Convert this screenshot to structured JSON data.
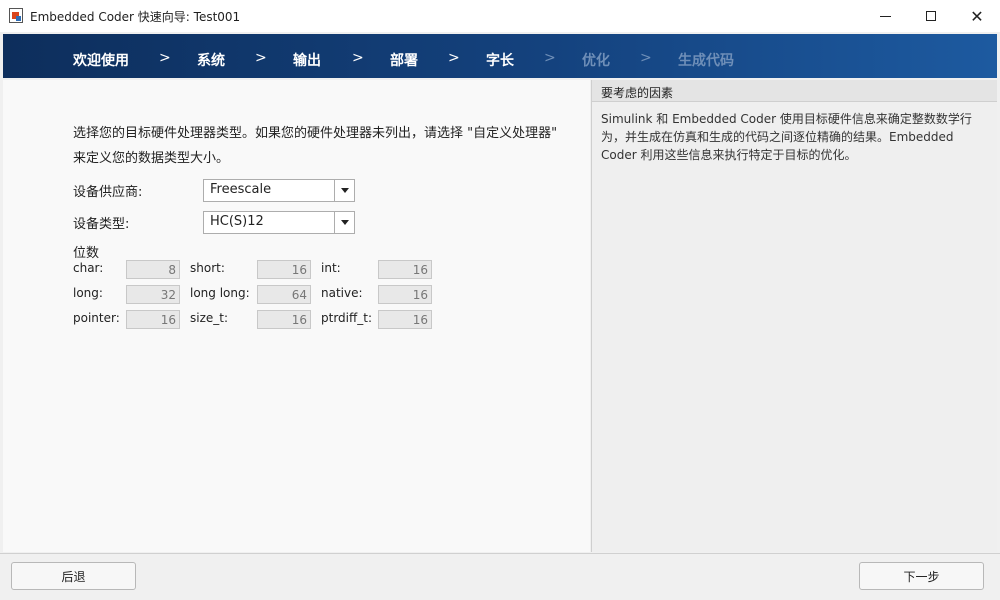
{
  "window": {
    "title": "Embedded Coder 快速向导: Test001",
    "minimize_icon": "minimize-icon",
    "maximize_icon": "maximize-icon",
    "close_glyph": "✕"
  },
  "steps": [
    {
      "label": "欢迎使用",
      "enabled": true
    },
    {
      "label": "系统",
      "enabled": true
    },
    {
      "label": "输出",
      "enabled": true
    },
    {
      "label": "部署",
      "enabled": true
    },
    {
      "label": "字长",
      "enabled": true
    },
    {
      "label": "优化",
      "enabled": false
    },
    {
      "label": "生成代码",
      "enabled": false
    }
  ],
  "step_separator": ">",
  "main": {
    "intro": "选择您的目标硬件处理器类型。如果您的硬件处理器未列出，请选择 \"自定义处理器\" 来定义您的数据类型大小。",
    "vendor_label": "设备供应商:",
    "vendor_value": "Freescale",
    "type_label": "设备类型:",
    "type_value": "HC(S)12",
    "bits_title": "位数",
    "bits": {
      "char_label": "char:",
      "char_value": "8",
      "short_label": "short:",
      "short_value": "16",
      "int_label": "int:",
      "int_value": "16",
      "long_label": "long:",
      "long_value": "32",
      "longlong_label": "long long:",
      "longlong_value": "64",
      "native_label": "native:",
      "native_value": "16",
      "pointer_label": "pointer:",
      "pointer_value": "16",
      "sizet_label": "size_t:",
      "sizet_value": "16",
      "ptrdiff_label": "ptrdiff_t:",
      "ptrdiff_value": "16"
    }
  },
  "side": {
    "header": "要考虑的因素",
    "text": "Simulink 和 Embedded Coder 使用目标硬件信息来确定整数数学行为，并生成在仿真和生成的代码之间逐位精确的结果。Embedded Coder 利用这些信息来执行特定于目标的优化。"
  },
  "footer": {
    "back_label": "后退",
    "next_label": "下一步"
  }
}
